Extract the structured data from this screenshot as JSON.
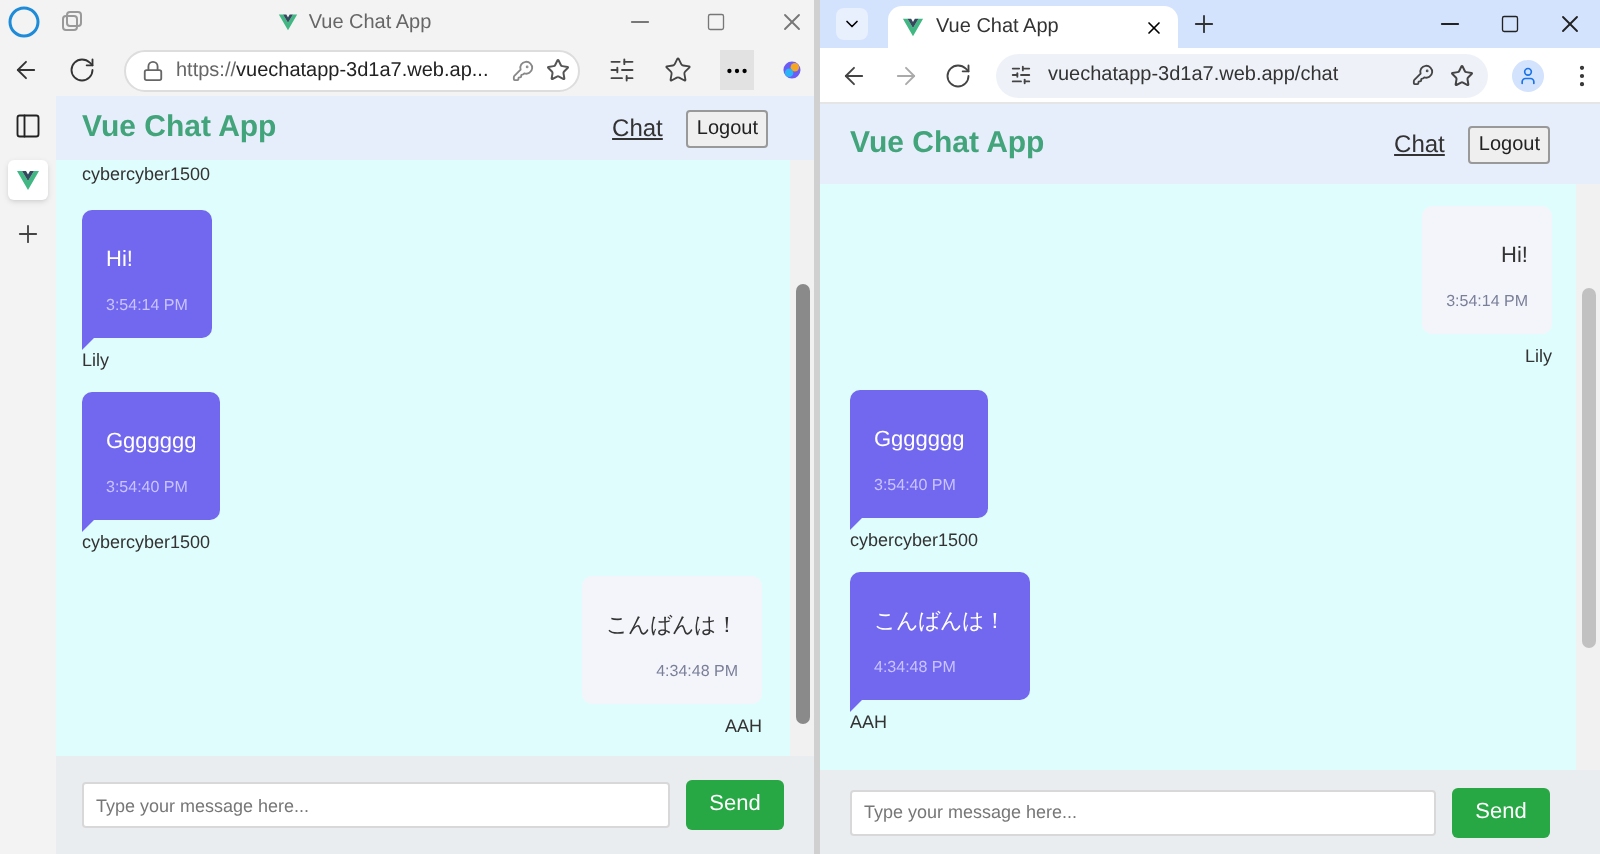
{
  "windows": [
    {
      "kind": "edge",
      "tab_title": "Vue Chat App",
      "url_prefix": "https://",
      "url_host": "vuechatapp-3d1a7.web.ap...",
      "app": {
        "title": "Vue Chat App",
        "nav_link": "Chat",
        "logout": "Logout",
        "partial_sender": "cybercyber1500",
        "messages": [
          {
            "text": "Hi!",
            "time": "3:54:14 PM",
            "sender": "Lily",
            "own": false
          },
          {
            "text": "Ggggggg",
            "time": "3:54:40 PM",
            "sender": "cybercyber1500",
            "own": false
          },
          {
            "text": "こんばんは！",
            "time": "4:34:48 PM",
            "sender": "AAH",
            "own": true
          }
        ],
        "input": {
          "placeholder": "Type your message here..."
        },
        "send": "Send"
      }
    },
    {
      "kind": "chrome",
      "tab_title": "Vue Chat App",
      "url_host": "vuechatapp-3d1a7.web.app/chat",
      "app": {
        "title": "Vue Chat App",
        "nav_link": "Chat",
        "logout": "Logout",
        "messages": [
          {
            "text": "Hi!",
            "time": "3:54:14 PM",
            "sender": "Lily",
            "own": true
          },
          {
            "text": "Ggggggg",
            "time": "3:54:40 PM",
            "sender": "cybercyber1500",
            "own": false
          },
          {
            "text": "こんばんは！",
            "time": "4:34:48 PM",
            "sender": "AAH",
            "own": false
          }
        ],
        "input": {
          "placeholder": "Type your message here..."
        },
        "send": "Send"
      }
    }
  ]
}
